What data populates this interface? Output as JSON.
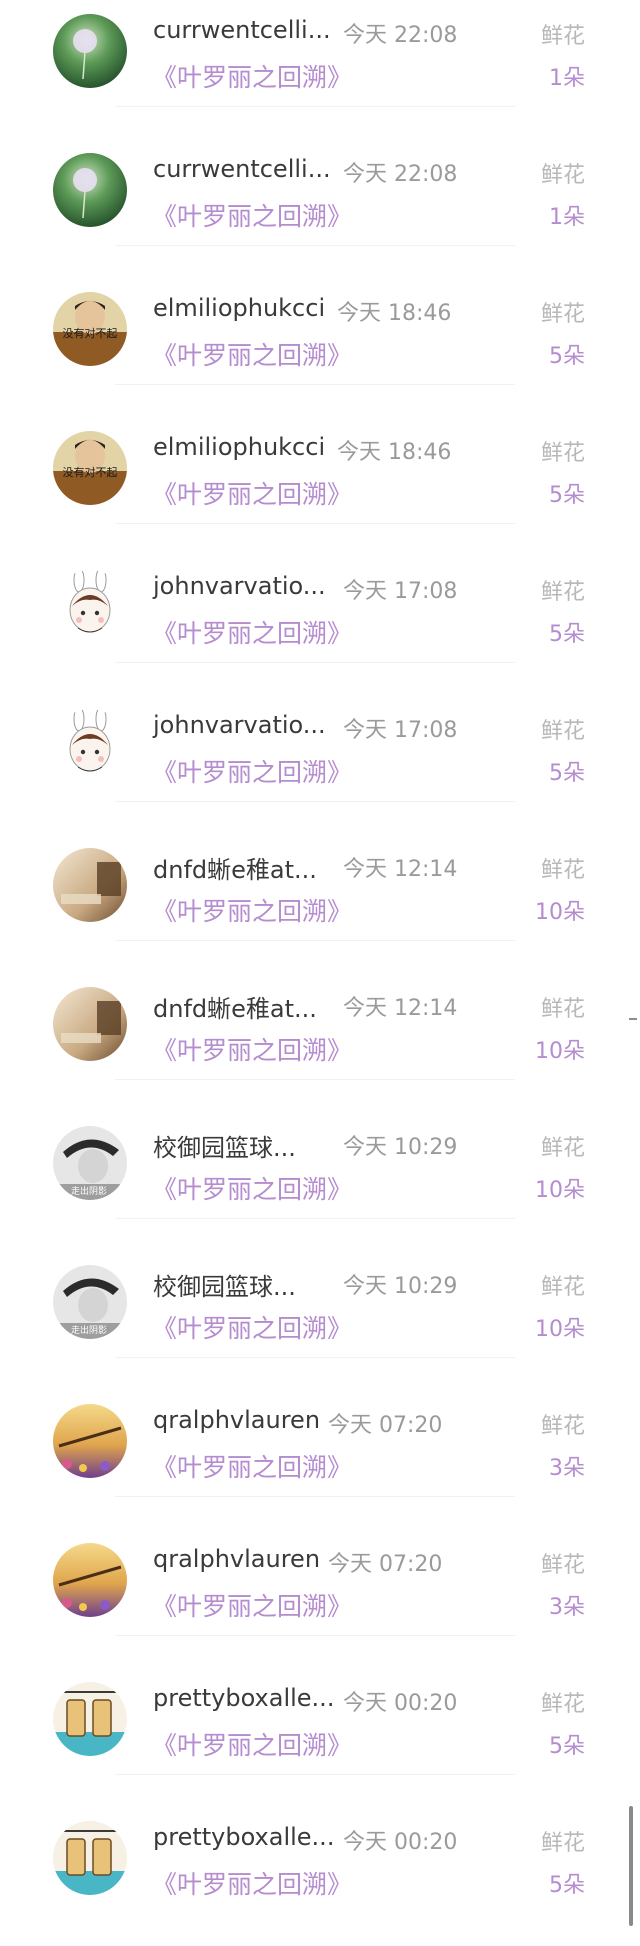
{
  "list": [
    {
      "name": "currwentcelli...",
      "time": "今天 22:08",
      "book": "《叶罗丽之回溯》",
      "gift": "鲜花",
      "count": "1朵",
      "avatar": "dandelion-avatar"
    },
    {
      "name": "currwentcelli...",
      "time": "今天 22:08",
      "book": "《叶罗丽之回溯》",
      "gift": "鲜花",
      "count": "1朵",
      "avatar": "dandelion-avatar"
    },
    {
      "name": "elmiliophukcci",
      "time": "今天 18:46",
      "book": "《叶罗丽之回溯》",
      "gift": "鲜花",
      "count": "5朵",
      "avatar": "boy-meme-avatar",
      "avatar_text": "没有对不起"
    },
    {
      "name": "elmiliophukcci",
      "time": "今天 18:46",
      "book": "《叶罗丽之回溯》",
      "gift": "鲜花",
      "count": "5朵",
      "avatar": "boy-meme-avatar",
      "avatar_text": "没有对不起"
    },
    {
      "name": "johnvarvatio...",
      "time": "今天 17:08",
      "book": "《叶罗丽之回溯》",
      "gift": "鲜花",
      "count": "5朵",
      "avatar": "bunny-girl-avatar"
    },
    {
      "name": "johnvarvatio...",
      "time": "今天 17:08",
      "book": "《叶罗丽之回溯》",
      "gift": "鲜花",
      "count": "5朵",
      "avatar": "bunny-girl-avatar"
    },
    {
      "name": "dnfd蜥e稚at...",
      "time": "今天 12:14",
      "book": "《叶罗丽之回溯》",
      "gift": "鲜花",
      "count": "10朵",
      "avatar": "sepia-room-avatar"
    },
    {
      "name": "dnfd蜥e稚at...",
      "time": "今天 12:14",
      "book": "《叶罗丽之回溯》",
      "gift": "鲜花",
      "count": "10朵",
      "avatar": "sepia-room-avatar"
    },
    {
      "name": "校御园篮球...",
      "time": "今天 10:29",
      "book": "《叶罗丽之回溯》",
      "gift": "鲜花",
      "count": "10朵",
      "avatar": "grayscale-boy-avatar",
      "avatar_text": "走出阴影"
    },
    {
      "name": "校御园篮球...",
      "time": "今天 10:29",
      "book": "《叶罗丽之回溯》",
      "gift": "鲜花",
      "count": "10朵",
      "avatar": "grayscale-boy-avatar",
      "avatar_text": "走出阴影"
    },
    {
      "name": "qralphvlauren",
      "time": "今天 07:20",
      "book": "《叶罗丽之回溯》",
      "gift": "鲜花",
      "count": "3朵",
      "avatar": "flower-text-avatar"
    },
    {
      "name": "qralphvlauren",
      "time": "今天 07:20",
      "book": "《叶罗丽之回溯》",
      "gift": "鲜花",
      "count": "3朵",
      "avatar": "flower-text-avatar"
    },
    {
      "name": "prettyboxalle...",
      "time": "今天 00:20",
      "book": "《叶罗丽之回溯》",
      "gift": "鲜花",
      "count": "5朵",
      "avatar": "cartoon-avatar"
    },
    {
      "name": "prettyboxalle...",
      "time": "今天 00:20",
      "book": "《叶罗丽之回溯》",
      "gift": "鲜花",
      "count": "5朵",
      "avatar": "cartoon-avatar"
    }
  ],
  "colors": {
    "name": "#3a3a3a",
    "time": "#9a9a9a",
    "gift_label": "#b8b8b8",
    "accent_purple": "#b48ccf"
  }
}
